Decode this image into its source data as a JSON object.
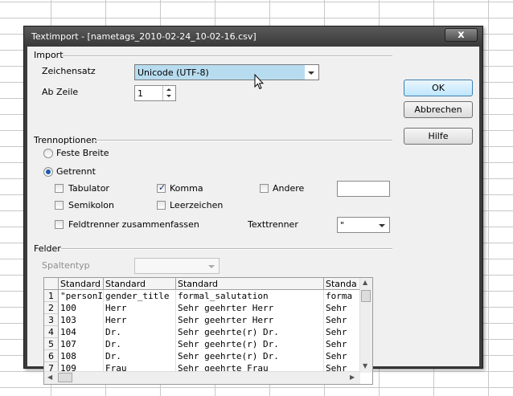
{
  "window": {
    "title": "Textimport - [nametags_2010-02-24_10-02-16.csv]",
    "close_glyph": "x"
  },
  "import_group": {
    "label": "Import",
    "charset_label": "Zeichensatz",
    "charset_value": "Unicode (UTF-8)",
    "from_row_label": "Ab Zeile",
    "from_row_value": "1"
  },
  "separator_group": {
    "label": "Trennoptionen",
    "fixed_width_label": "Feste Breite",
    "separated_label": "Getrennt",
    "tab_label": "Tabulator",
    "comma_label": "Komma",
    "other_label": "Andere",
    "semicolon_label": "Semikolon",
    "space_label": "Leerzeichen",
    "merge_label": "Feldtrenner zusammenfassen",
    "text_delimiter_label": "Texttrenner",
    "text_delimiter_value": "\"",
    "state": {
      "fixed_width": false,
      "separated": true,
      "tab": false,
      "comma": true,
      "other": false,
      "semicolon": false,
      "space": false,
      "merge": false
    }
  },
  "fields_group": {
    "label": "Felder",
    "column_type_label": "Spaltentyp"
  },
  "buttons": {
    "ok": "OK",
    "cancel": "Abbrechen",
    "help": "Hilfe"
  },
  "preview": {
    "headers": [
      "Standard",
      "Standard",
      "Standard",
      "Standa"
    ],
    "rows": [
      {
        "n": "1",
        "c": [
          "\"personID\"",
          "gender_title",
          "formal_salutation",
          "forma"
        ]
      },
      {
        "n": "2",
        "c": [
          "100",
          "Herr",
          "Sehr geehrter Herr",
          "Sehr"
        ]
      },
      {
        "n": "3",
        "c": [
          "103",
          "Herr",
          "Sehr geehrter Herr",
          "Sehr"
        ]
      },
      {
        "n": "4",
        "c": [
          "104",
          "Dr.",
          "Sehr geehrte(r) Dr.",
          "Sehr"
        ]
      },
      {
        "n": "5",
        "c": [
          "107",
          "Dr.",
          "Sehr geehrte(r) Dr.",
          "Sehr"
        ]
      },
      {
        "n": "6",
        "c": [
          "108",
          "Dr.",
          "Sehr geehrte(r) Dr.",
          "Sehr"
        ]
      },
      {
        "n": "7",
        "c": [
          "109",
          "Frau",
          "Sehr geehrte Frau",
          "Sehr"
        ]
      }
    ]
  }
}
